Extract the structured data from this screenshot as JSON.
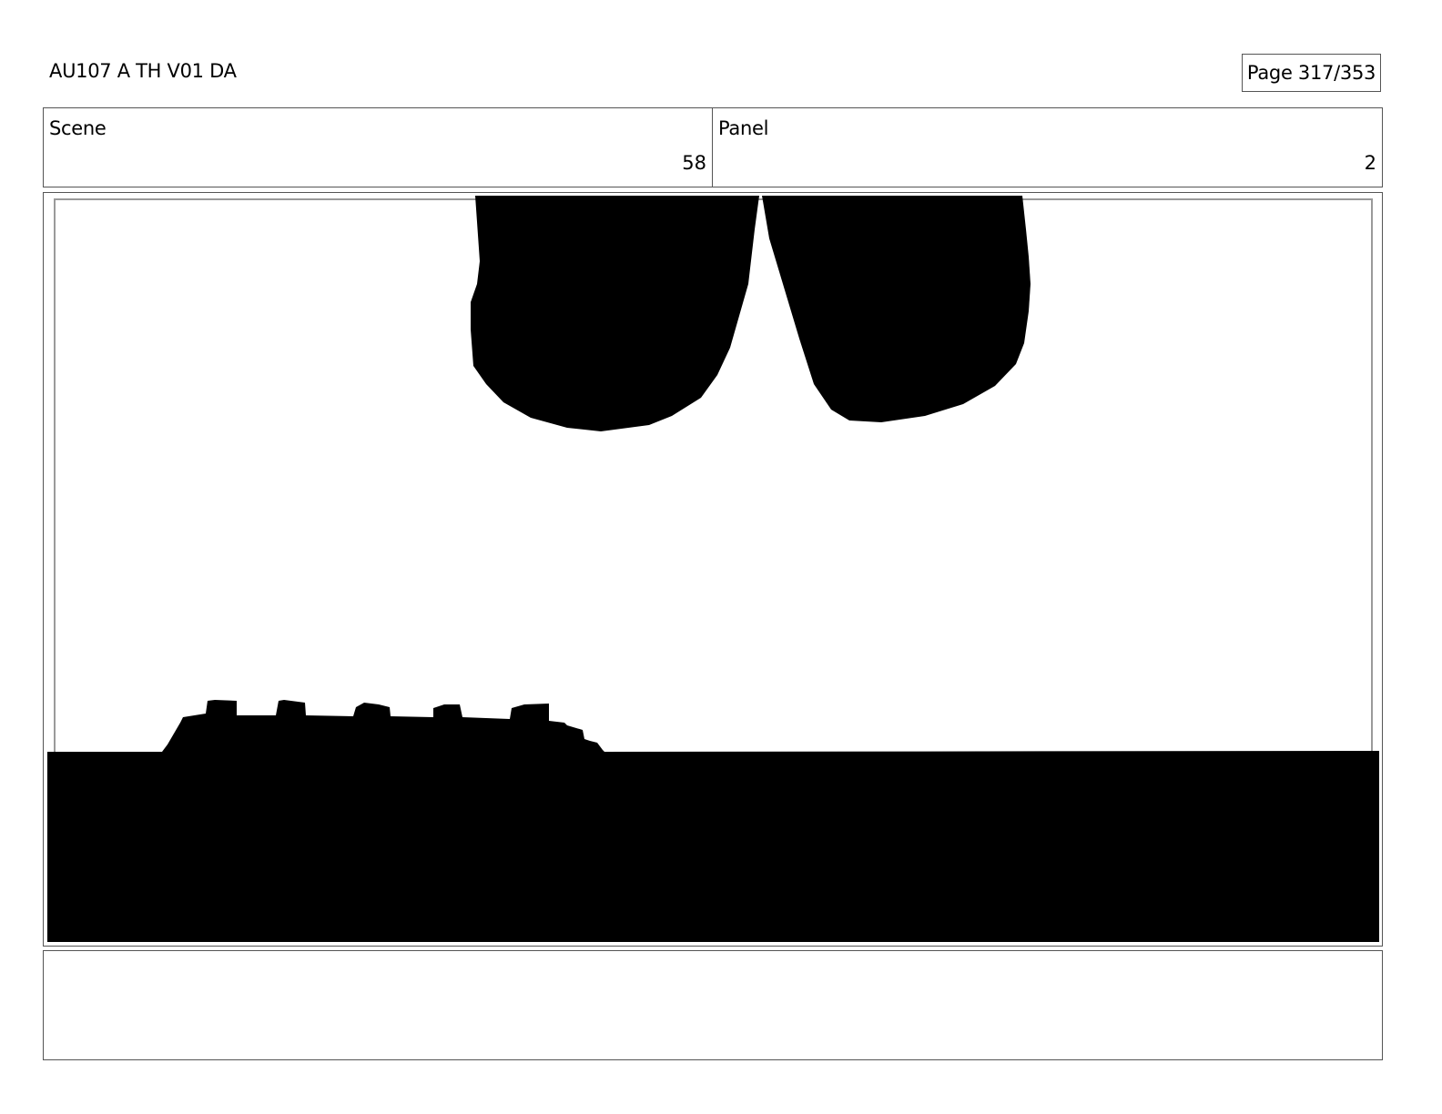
{
  "header": {
    "document_title": "AU107 A TH V01 DA",
    "page_indicator": "Page 317/353"
  },
  "info": {
    "scene_label": "Scene",
    "scene_value": "58",
    "panel_label": "Panel",
    "panel_value": "2"
  },
  "notes": {
    "text": ""
  }
}
